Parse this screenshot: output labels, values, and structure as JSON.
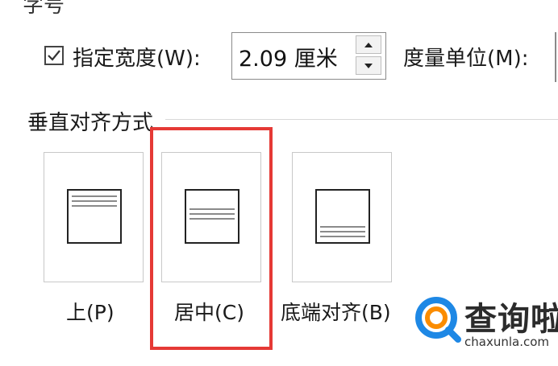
{
  "group_label": "字号",
  "width_setting": {
    "checkbox_checked": true,
    "label": "指定宽度(W):",
    "value": "2.09 厘米",
    "measure_label": "度量单位(M):"
  },
  "vertical_alignment": {
    "title": "垂直对齐方式",
    "options": [
      {
        "label": "上(P)",
        "selected": false,
        "alignment": "top"
      },
      {
        "label": "居中(C)",
        "selected": true,
        "alignment": "center"
      },
      {
        "label": "底端对齐(B)",
        "selected": false,
        "alignment": "bottom"
      }
    ]
  },
  "watermark": {
    "text": "查询啦",
    "url": "chaxunla.com"
  },
  "colors": {
    "highlight": "#e53935",
    "watermark_blue": "#1e88e5",
    "watermark_orange": "#fb8c00"
  }
}
